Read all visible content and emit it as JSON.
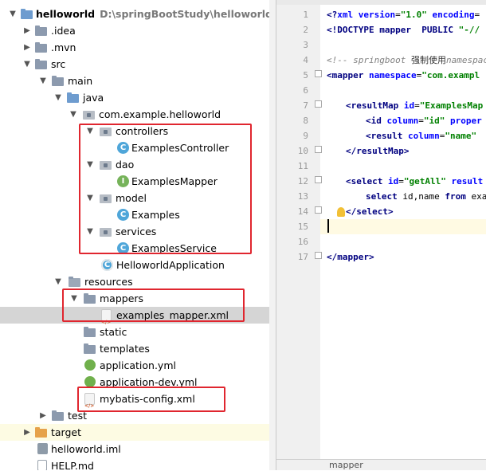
{
  "project": {
    "root_name": "helloworld",
    "root_path": "D:\\springBootStudy\\helloworld",
    "idea": ".idea",
    "mvn": ".mvn",
    "src": "src",
    "main": "main",
    "java": "java",
    "package": "com.example.helloworld",
    "controllers": "controllers",
    "examples_controller": "ExamplesController",
    "dao": "dao",
    "examples_mapper": "ExamplesMapper",
    "model": "model",
    "examples": "Examples",
    "services": "services",
    "examples_service": "ExamplesService",
    "helloworld_application": "HelloworldApplication",
    "resources": "resources",
    "mappers": "mappers",
    "examples_mapper_xml": "examples_mapper.xml",
    "static": "static",
    "templates": "templates",
    "application_yml": "application.yml",
    "application_dev_yml": "application-dev.yml",
    "mybatis_config": "mybatis-config.xml",
    "test": "test",
    "target": "target",
    "helloworld_iml": "helloworld.iml",
    "help_md": "HELP.md"
  },
  "class_badges": {
    "class": "C",
    "interface": "I"
  },
  "editor": {
    "line_numbers": [
      "1",
      "2",
      "3",
      "4",
      "5",
      "6",
      "7",
      "8",
      "9",
      "10",
      "11",
      "12",
      "13",
      "14",
      "15",
      "16",
      "17"
    ],
    "l1_a": "<?",
    "l1_b": "xml version",
    "l1_c": "=",
    "l1_d": "\"1.0\"",
    "l1_e": " encoding",
    "l1_f": "=",
    "l2_a": "<!DOCTYPE mapper  PUBLIC ",
    "l2_b": "\"-//",
    "l4_a": "<!-- ",
    "l4_b": "springboot",
    "l4_c": " 强制使用",
    "l4_d": "namespace",
    "l5_a": "<mapper ",
    "l5_b": "namespace",
    "l5_c": "=",
    "l5_d": "\"com.exampl",
    "l7_a": "<resultMap ",
    "l7_b": "id",
    "l7_c": "=",
    "l7_d": "\"ExamplesMap",
    "l8_a": "<id ",
    "l8_b": "column",
    "l8_c": "=",
    "l8_d": "\"id\"",
    "l8_e": " proper",
    "l9_a": "<result ",
    "l9_b": "column",
    "l9_c": "=",
    "l9_d": "\"name\"",
    "l10": "</resultMap>",
    "l12_a": "<select ",
    "l12_b": "id",
    "l12_c": "=",
    "l12_d": "\"getAll\"",
    "l12_e": " result",
    "l13_a": "select ",
    "l13_b": "id",
    "l13_c": ",",
    "l13_d": "name ",
    "l13_e": "from ",
    "l13_f": "exa",
    "l14": "</select>",
    "l17": "</mapper>"
  },
  "bottom_tab": {
    "label": "mapper"
  },
  "colors": {
    "highlight_box": "#e0262f",
    "selection": "#d5d5d5"
  }
}
